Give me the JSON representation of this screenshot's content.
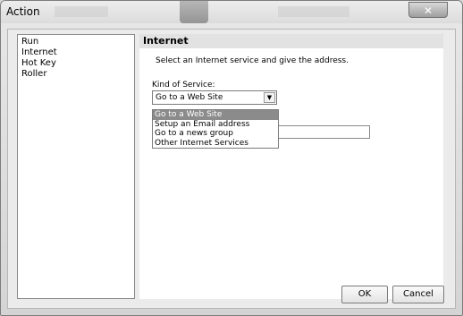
{
  "window": {
    "title": "Action",
    "close_glyph": "✕"
  },
  "sidebar": {
    "items": [
      {
        "label": "Run"
      },
      {
        "label": "Internet"
      },
      {
        "label": "Hot Key"
      },
      {
        "label": "Roller"
      }
    ]
  },
  "panel": {
    "header": "Internet",
    "instruction": "Select an Internet service and give the address.",
    "kind_label": "Kind of Service:",
    "combo_value": "Go to a Web Site",
    "combo_arrow": "▼",
    "options": [
      {
        "label": "Go to a Web Site"
      },
      {
        "label": "Setup an Email address"
      },
      {
        "label": "Go to a news group"
      },
      {
        "label": "Other Internet Services"
      }
    ]
  },
  "buttons": {
    "ok": "OK",
    "cancel": "Cancel"
  }
}
